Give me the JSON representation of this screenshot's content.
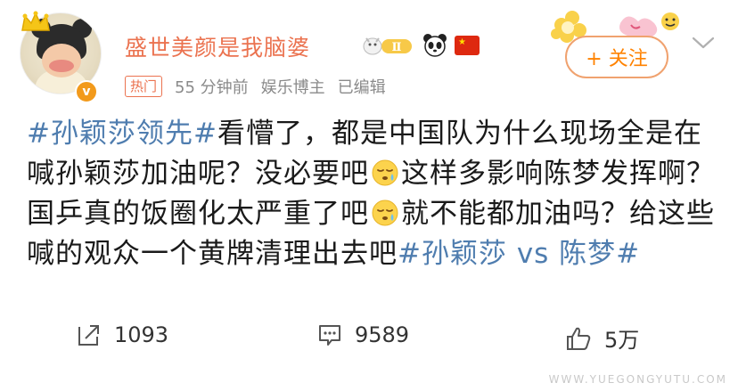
{
  "post": {
    "username": "盛世美颜是我脑婆",
    "level_badge": "Ⅱ",
    "hot_tag": "热门",
    "time": "55 分钟前",
    "author_label": "娱乐博主",
    "edited": "已编辑",
    "follow_label": "+ 关注",
    "content": {
      "topic1": "#孙颖莎领先#",
      "text1": "看懵了，都是中国队为什么现场全是在喊孙颖莎加油呢？没必要吧",
      "text2": "这样多影响陈梦发挥啊？国乒真的饭圈化太严重了吧",
      "text3": "就不能都加油吗？给这些喊的观众一个黄牌清理出去吧",
      "topic2": "#孙颖莎 vs 陈梦#"
    }
  },
  "actions": {
    "repost_count": "1093",
    "comment_count": "9589",
    "like_count": "5万"
  },
  "watermark": "WWW.YUEGONGYUTU.COM",
  "colors": {
    "username": "#eb7350",
    "topic": "#4f7daf",
    "follow": "#ff8200",
    "meta": "#8a8a8a"
  },
  "icons": [
    "crown-icon",
    "verified-badge-icon",
    "level-badge-icon",
    "panda-icon",
    "china-flag-icon",
    "chevron-down-icon",
    "sleepy-emoji-icon",
    "repost-icon",
    "comment-icon",
    "like-icon"
  ]
}
